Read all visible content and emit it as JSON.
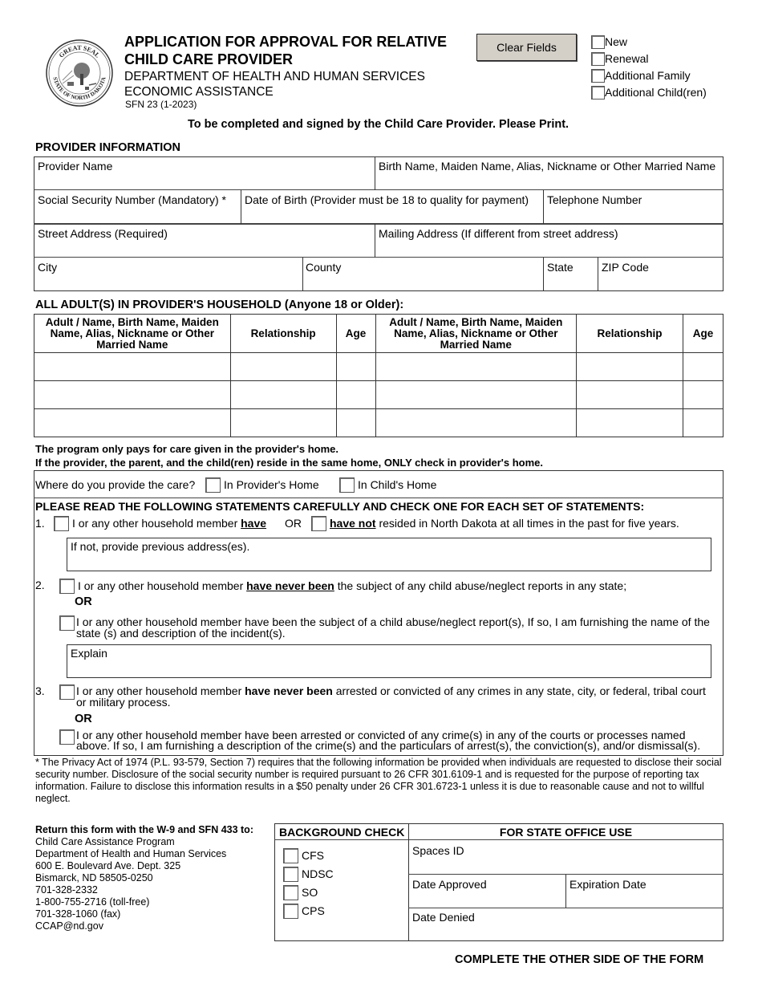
{
  "header": {
    "title_line1": "APPLICATION FOR APPROVAL FOR RELATIVE",
    "title_line2": "CHILD CARE PROVIDER",
    "department": "DEPARTMENT OF HEALTH AND HUMAN SERVICES",
    "division": "ECONOMIC ASSISTANCE",
    "form_number": "SFN 23 (1-2023)",
    "seal_top_text": "GREAT SEAL",
    "seal_bottom_text": "STATE OF NORTH DAKOTA",
    "clear_button": "Clear Fields",
    "application_types": [
      {
        "label": "New",
        "checked": false
      },
      {
        "label": "Renewal",
        "checked": false
      },
      {
        "label": "Additional Family",
        "checked": false
      },
      {
        "label": "Additional Child(ren)",
        "checked": false
      }
    ]
  },
  "instruction": "To be completed and signed by the Child Care Provider.  Please Print.",
  "provider_info": {
    "heading": "PROVIDER INFORMATION",
    "fields": {
      "provider_name": {
        "label": "Provider Name",
        "value": ""
      },
      "other_names": {
        "label": "Birth Name, Maiden Name, Alias, Nickname or Other Married  Name",
        "value": ""
      },
      "ssn": {
        "label": "Social Security Number  (Mandatory) *",
        "value": ""
      },
      "dob": {
        "label": "Date of Birth (Provider must be 18 to quality for payment)",
        "value": ""
      },
      "phone": {
        "label": "Telephone Number",
        "value": ""
      },
      "street": {
        "label": "Street Address (Required)",
        "value": ""
      },
      "mailing": {
        "label": "Mailing Address (If different from street address)",
        "value": ""
      },
      "city": {
        "label": "City",
        "value": ""
      },
      "county": {
        "label": "County",
        "value": ""
      },
      "state": {
        "label": "State",
        "value": ""
      },
      "zip": {
        "label": "ZIP Code",
        "value": ""
      }
    }
  },
  "adults": {
    "heading": "ALL  ADULT(S) IN PROVIDER'S HOUSEHOLD (Anyone 18 or Older):",
    "columns": [
      "Adult / Name, Birth Name, Maiden Name, Alias, Nickname or Other Married  Name",
      "Relationship",
      "Age",
      "Adult / Name, Birth Name, Maiden Name, Alias, Nickname or Other Married  Name",
      "Relationship",
      "Age"
    ],
    "rows": [
      [
        "",
        "",
        "",
        "",
        "",
        ""
      ],
      [
        "",
        "",
        "",
        "",
        "",
        ""
      ],
      [
        "",
        "",
        "",
        "",
        "",
        ""
      ]
    ]
  },
  "care_notes": {
    "line1": "The program only pays for care given in the provider's home.",
    "line2": "If the provider, the parent, and the child(ren) reside in the same home, ONLY check in provider's home."
  },
  "care_location": {
    "question": "Where do you provide the care?",
    "options": [
      {
        "label": "In Provider's Home",
        "checked": false
      },
      {
        "label": "In Child's Home",
        "checked": false
      }
    ]
  },
  "statements": {
    "heading": "PLEASE READ THE FOLLOWING STATEMENTS CAREFULLY AND CHECK ONE FOR EACH SET OF STATEMENTS:",
    "s1": {
      "number": "1.",
      "a_text": "I or any other household member ",
      "a_emph": "have",
      "or": "OR",
      "b_emph": "have not",
      "b_text": " resided in North Dakota at all times in the past for five years.",
      "address_label": "If not, provide previous address(es).",
      "address_value": ""
    },
    "s2": {
      "number": "2.",
      "a_pre": "I or any other household member ",
      "a_emph": "have never been",
      "a_post": " the subject of any child abuse/neglect reports in any state;",
      "or": "OR",
      "b_text": "I or any other household member have been the subject of a child abuse/neglect report(s),  If so, I am furnishing the name of the state (s)  and description of the incident(s).",
      "explain_label": "Explain",
      "explain_value": ""
    },
    "s3": {
      "number": "3.",
      "a_pre": "I or any other household member ",
      "a_emph": "have never been",
      "a_post": " arrested or convicted of any crimes in any state, city, or federal, tribal court or military process.",
      "or": "OR",
      "b_text": "I or any other household member have been arrested or convicted of any crime(s) in any of the courts or processes named above.  If so, I am furnishing a description of the crime(s) and the particulars of arrest(s), the conviction(s), and/or dismissal(s)."
    }
  },
  "privacy_notice": "* The Privacy Act of 1974 (P.L. 93-579, Section 7) requires that the following information be provided when individuals are requested to disclose their social security number.  Disclosure of the social security number is required pursuant to 26 CFR 301.6109-1 and is requested for the purpose of reporting tax information.  Failure to disclose this information results in a $50 penalty under 26 CFR 301.6723-1 unless it is due to reasonable cause and not to willful neglect.",
  "return_info": {
    "heading": "Return this form with the W-9 and SFN 433 to:",
    "lines": [
      "Child Care Assistance Program",
      "Department of Health and Human Services",
      "600 E. Boulevard Ave. Dept. 325",
      "Bismarck, ND  58505-0250",
      "701-328-2332",
      "1-800-755-2716 (toll-free)",
      "701-328-1060 (fax)",
      "CCAP@nd.gov"
    ]
  },
  "background_check": {
    "heading": "BACKGROUND CHECK",
    "items": [
      {
        "label": "CFS",
        "checked": false
      },
      {
        "label": "NDSC",
        "checked": false
      },
      {
        "label": "SO",
        "checked": false
      },
      {
        "label": "CPS",
        "checked": false
      }
    ]
  },
  "state_office": {
    "heading": "FOR STATE OFFICE USE",
    "spaces_id": "Spaces ID",
    "date_approved": "Date Approved",
    "expiration_date": "Expiration Date",
    "date_denied": "Date Denied"
  },
  "footer": "COMPLETE THE OTHER SIDE OF THE FORM"
}
